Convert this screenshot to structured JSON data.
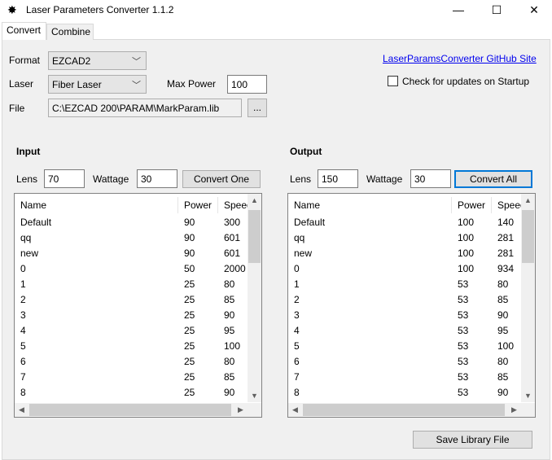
{
  "window": {
    "title": "Laser Parameters Converter 1.1.2",
    "minimize": "—",
    "maximize": "☐",
    "close": "✕"
  },
  "tabs": [
    {
      "label": "Convert"
    },
    {
      "label": "Combine"
    }
  ],
  "settings": {
    "format_label": "Format",
    "format_value": "EZCAD2",
    "laser_label": "Laser",
    "laser_value": "Fiber Laser",
    "max_power_label": "Max Power",
    "max_power_value": "100",
    "file_label": "File",
    "file_value": "C:\\EZCAD 200\\PARAM\\MarkParam.lib",
    "browse_label": "...",
    "github_link": "LaserParamsConverter GitHub Site",
    "update_check_label": "Check for updates on Startup",
    "update_check_checked": false
  },
  "input": {
    "heading": "Input",
    "lens_label": "Lens",
    "lens_value": "70",
    "wattage_label": "Wattage",
    "wattage_value": "30",
    "button": "Convert One",
    "columns": [
      "Name",
      "Power",
      "Speed"
    ],
    "rows": [
      [
        "Default",
        "90",
        "300"
      ],
      [
        "qq",
        "90",
        "601"
      ],
      [
        "new",
        "90",
        "601"
      ],
      [
        "0",
        "50",
        "2000"
      ],
      [
        "1",
        "25",
        "80"
      ],
      [
        "2",
        "25",
        "85"
      ],
      [
        "3",
        "25",
        "90"
      ],
      [
        "4",
        "25",
        "95"
      ],
      [
        "5",
        "25",
        "100"
      ],
      [
        "6",
        "25",
        "80"
      ],
      [
        "7",
        "25",
        "85"
      ],
      [
        "8",
        "25",
        "90"
      ]
    ]
  },
  "output": {
    "heading": "Output",
    "lens_label": "Lens",
    "lens_value": "150",
    "wattage_label": "Wattage",
    "wattage_value": "30",
    "button": "Convert All",
    "columns": [
      "Name",
      "Power",
      "Speed"
    ],
    "rows": [
      [
        "Default",
        "100",
        "140"
      ],
      [
        "qq",
        "100",
        "281"
      ],
      [
        "new",
        "100",
        "281"
      ],
      [
        "0",
        "100",
        "934"
      ],
      [
        "1",
        "53",
        "80"
      ],
      [
        "2",
        "53",
        "85"
      ],
      [
        "3",
        "53",
        "90"
      ],
      [
        "4",
        "53",
        "95"
      ],
      [
        "5",
        "53",
        "100"
      ],
      [
        "6",
        "53",
        "80"
      ],
      [
        "7",
        "53",
        "85"
      ],
      [
        "8",
        "53",
        "90"
      ]
    ]
  },
  "save_button": "Save Library File"
}
